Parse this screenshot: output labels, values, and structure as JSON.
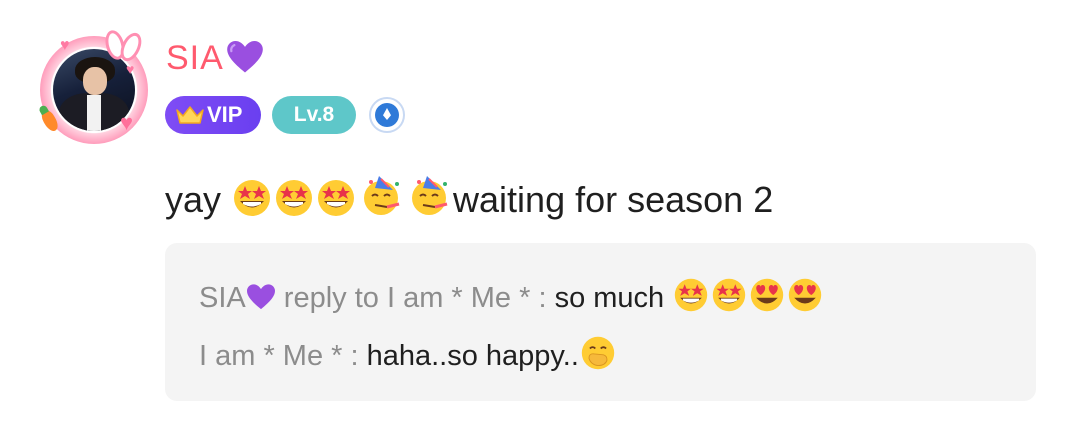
{
  "comment": {
    "author": {
      "name": "SIA",
      "name_emoji": "purple-heart",
      "avatar": "user-avatar-photo",
      "avatar_frame": "pink-bunny-heart-frame"
    },
    "badges": {
      "vip_label": "VIP",
      "vip_icon": "crown-icon",
      "level_label": "Lv.8",
      "extra_badge_icon": "blue-medal-icon"
    },
    "text": {
      "prefix": "yay ",
      "suffix": "waiting for season 2",
      "emojis": [
        "star-struck",
        "star-struck",
        "star-struck",
        "partying-face",
        "partying-face"
      ]
    },
    "replies": [
      {
        "author": "SIA",
        "author_emoji": "purple-heart",
        "connector": " reply to I am * Me * : ",
        "text": "so much ",
        "emojis": [
          "star-struck",
          "star-struck",
          "heart-eyes",
          "heart-eyes"
        ]
      },
      {
        "author": "I am * Me *",
        "connector": " : ",
        "text": "haha..so happy..",
        "emojis": [
          "hand-over-mouth"
        ]
      }
    ]
  },
  "colors": {
    "username": "#ff5a6e",
    "vip_badge": "#6a3ff0",
    "level_badge": "#5ec7c9",
    "reply_bg": "#f4f4f4",
    "reply_gray": "#8c8c8c",
    "text_dark": "#1f1f1f"
  }
}
